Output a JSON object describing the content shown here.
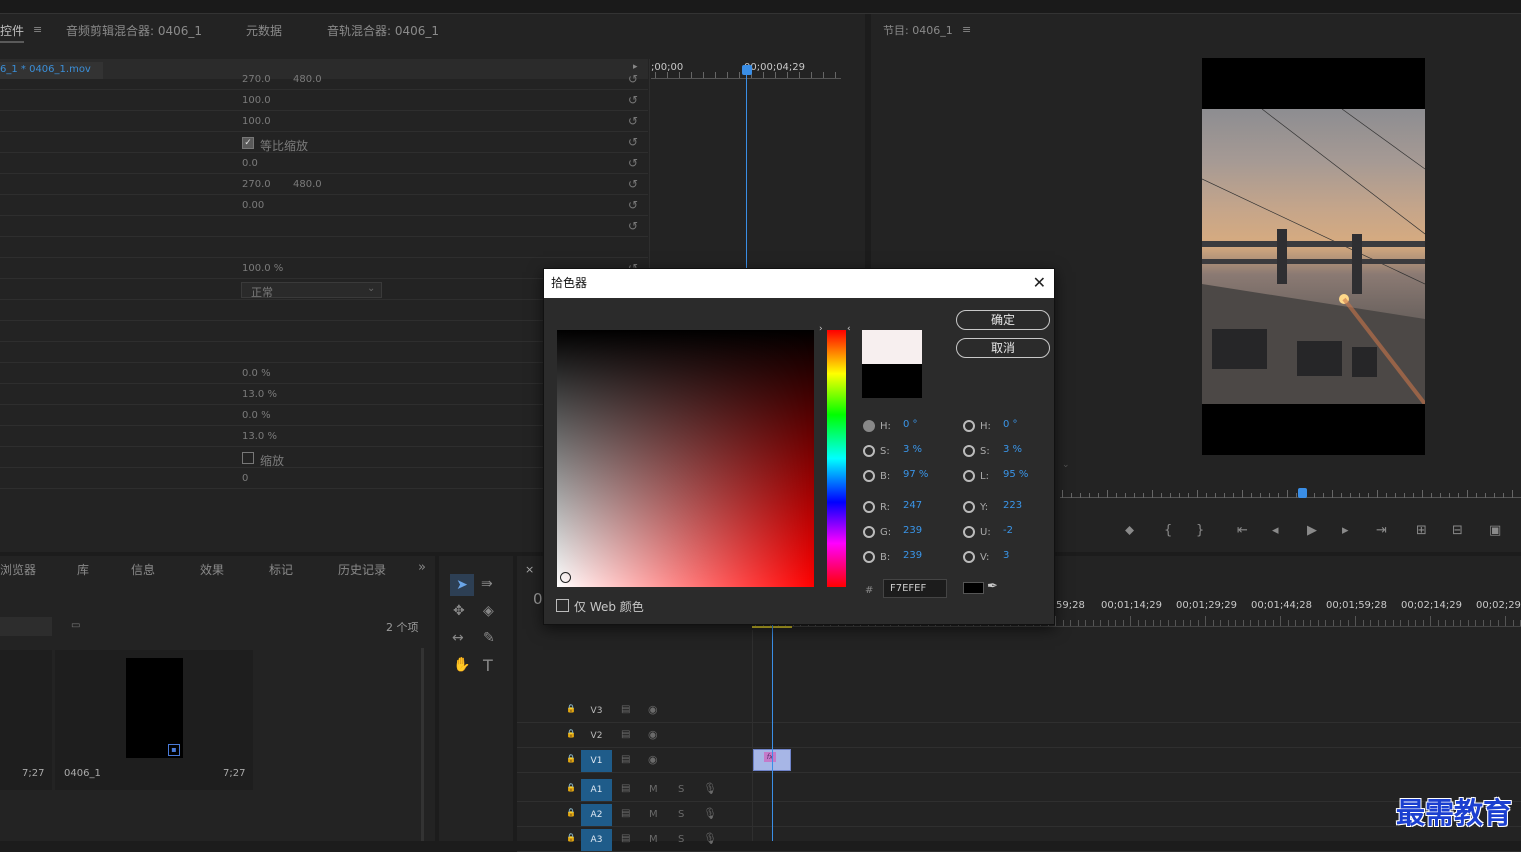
{
  "topPanel": {
    "tabs": [
      "控件",
      "音频剪辑混合器: 0406_1",
      "元数据",
      "音轨混合器: 0406_1"
    ],
    "clip_label": "6_1 * 0406_1.mov",
    "timecode_start": ";00;00",
    "timecode_playhead": "00;00;04;29"
  },
  "effectRows": [
    {
      "value": "270.0",
      "value2": "480.0"
    },
    {
      "value": "100.0"
    },
    {
      "value": "100.0"
    },
    {
      "value": "等比缩放",
      "checkbox": true,
      "checked": true
    },
    {
      "value": "0.0"
    },
    {
      "value": "270.0",
      "value2": "480.0"
    },
    {
      "value": "0.00"
    },
    {
      "value": ""
    },
    {
      "value": ""
    },
    {
      "value": "100.0 %"
    },
    {
      "value": "正常",
      "dropdown": true
    },
    {
      "value": ""
    },
    {
      "value": ""
    },
    {
      "value": ""
    },
    {
      "value": "0.0 %"
    },
    {
      "value": "13.0 %"
    },
    {
      "value": "0.0 %"
    },
    {
      "value": "13.0 %"
    },
    {
      "value": "缩放",
      "checkbox": true,
      "checked": false
    },
    {
      "value": "0"
    }
  ],
  "programMonitor": {
    "tab": "节目: 0406_1"
  },
  "projectPanel": {
    "tabs": [
      "浏览器",
      "库",
      "信息",
      "效果",
      "标记",
      "历史记录"
    ],
    "overflow": "»",
    "item_count": "2 个项",
    "item1_duration": "7;27",
    "item2_name": "0406_1",
    "item2_duration": "7;27"
  },
  "timeline": {
    "close": "×",
    "current_tc_fragment": "0",
    "ruler": [
      "59;28",
      "00;01;14;29",
      "00;01;29;29",
      "00;01;44;28",
      "00;01;59;28",
      "00;02;14;29",
      "00;02;29"
    ],
    "video_tracks": [
      "V3",
      "V2",
      "V1"
    ],
    "audio_tracks": [
      "A1",
      "A2",
      "A3"
    ],
    "m": "M",
    "s": "S",
    "clip_badge": "fx"
  },
  "colorPicker": {
    "title": "拾色器",
    "ok": "确定",
    "cancel": "取消",
    "web_only": "仅 Web 颜色",
    "hsb": {
      "H": "0 °",
      "S": "3 %",
      "B": "97 %"
    },
    "hsl": {
      "H": "0 °",
      "S": "3 %",
      "L": "95 %"
    },
    "rgb": {
      "R": "247",
      "G": "239",
      "B": "239"
    },
    "yuv": {
      "Y": "223",
      "U": "-2",
      "V": "3"
    },
    "hex_prefix": "#",
    "hex": "F7EFEF",
    "new_color": "#F7EFEF",
    "old_color": "#000000",
    "hue_color": "#FF0000"
  },
  "watermark": "最需教育"
}
